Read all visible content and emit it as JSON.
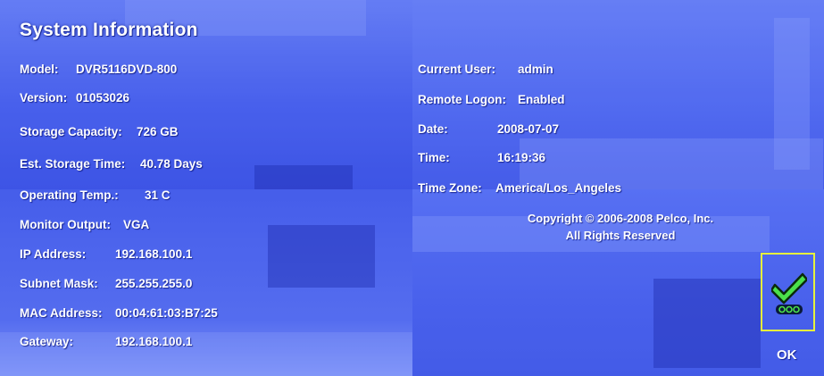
{
  "window": {
    "title": "System Information"
  },
  "left_fields": [
    {
      "label": "Model:",
      "value": "DVR5116DVD-800"
    },
    {
      "label": "Version:",
      "value": "01053026"
    },
    {
      "label": "Storage Capacity:",
      "value": "726  GB"
    },
    {
      "label": "Est. Storage Time:",
      "value": "40.78   Days"
    },
    {
      "label": "Operating Temp.:",
      "value": "31  C"
    },
    {
      "label": "Monitor Output:",
      "value": "VGA"
    },
    {
      "label": "IP Address:",
      "value": "192.168.100.1"
    },
    {
      "label": "Subnet Mask:",
      "value": "255.255.255.0"
    },
    {
      "label": "MAC Address:",
      "value": "00:04:61:03:B7:25"
    },
    {
      "label": "Gateway:",
      "value": "192.168.100.1"
    }
  ],
  "right_fields": [
    {
      "label": "Current User:",
      "value": "admin"
    },
    {
      "label": "Remote Logon:",
      "value": "Enabled"
    },
    {
      "label": "Date:",
      "value": "2008-07-07"
    },
    {
      "label": "Time:",
      "value": "16:19:36"
    },
    {
      "label": "Time Zone:",
      "value": "America/Los_Angeles"
    }
  ],
  "copyright": {
    "line1": "Copyright © 2006-2008 Pelco, Inc.",
    "line2": "All Rights Reserved"
  },
  "ok_button": {
    "label": "OK",
    "icon": "checkmark-icon"
  },
  "colors": {
    "background": "#4b63f0",
    "text": "#ffffff",
    "ok_border": "#e6f23c",
    "check_green": "#4be04b"
  }
}
